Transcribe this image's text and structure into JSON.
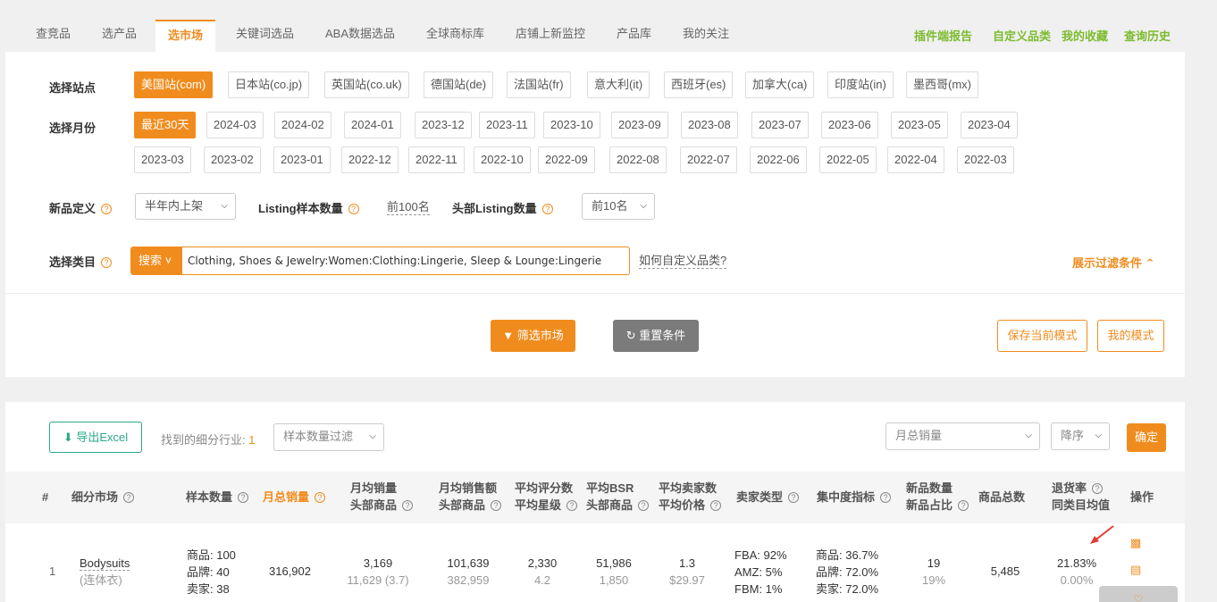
{
  "tabs": [
    "查竞品",
    "选产品",
    "选市场",
    "关键词选品",
    "ABA数据选品",
    "全球商标库",
    "店铺上新监控",
    "产品库",
    "我的关注"
  ],
  "top_links": [
    "插件端报告",
    "自定义品类",
    "我的收藏",
    "查询历史"
  ],
  "filters": {
    "site_label": "选择站点",
    "sites": [
      "美国站(com)",
      "日本站(co.jp)",
      "英国站(co.uk)",
      "德国站(de)",
      "法国站(fr)",
      "意大利(it)",
      "西班牙(es)",
      "加拿大(ca)",
      "印度站(in)",
      "墨西哥(mx)"
    ],
    "month_label": "选择月份",
    "months_row1": [
      "最近30天",
      "2024-03",
      "2024-02",
      "2024-01",
      "2023-12",
      "2023-11",
      "2023-10",
      "2023-09",
      "2023-08",
      "2023-07",
      "2023-06",
      "2023-05",
      "2023-04"
    ],
    "months_row2": [
      "2023-03",
      "2023-02",
      "2023-01",
      "2022-12",
      "2022-11",
      "2022-10",
      "2022-09",
      "2022-08",
      "2022-07",
      "2022-06",
      "2022-05",
      "2022-04",
      "2022-03"
    ],
    "newdef_label": "新品定义",
    "newdef_value": "半年内上架",
    "listing_label": "Listing样本数量",
    "listing_value": "前100名",
    "head_label": "头部Listing数量",
    "head_value": "前10名",
    "category_label": "选择类目",
    "search_btn": "搜索",
    "category_value": "Clothing, Shoes & Jewelry:Women:Clothing:Lingerie, Sleep & Lounge:Lingerie",
    "custom_link": "如何自定义品类?",
    "expand": "展示过滤条件",
    "filter_btn": "筛选市场",
    "reset_btn": "重置条件",
    "save_btn": "保存当前模式",
    "my_mode_btn": "我的模式"
  },
  "results": {
    "export_btn": "导出Excel",
    "found_label": "找到的细分行业:",
    "found_count": "1",
    "sample_filter": "样本数量过滤",
    "sort_field": "月总销量",
    "sort_order": "降序",
    "confirm": "确定",
    "headers": {
      "idx": "#",
      "market": "细分市场",
      "sample": "样本数量",
      "total_sales": "月总销量",
      "avg_sales_1": "月均销量",
      "avg_sales_2": "头部商品",
      "avg_rev_1": "月均销售额",
      "avg_rev_2": "头部商品",
      "rating_1": "平均评分数",
      "rating_2": "平均星级",
      "bsr_1": "平均BSR",
      "bsr_2": "头部商品",
      "seller_1": "平均卖家数",
      "seller_2": "平均价格",
      "seller_type": "卖家类型",
      "concentration": "集中度指标",
      "newcount_1": "新品数量",
      "newcount_2": "新品占比",
      "total_products": "商品总数",
      "return_1": "退货率",
      "return_2": "同类目均值",
      "ops": "操作"
    },
    "rows": [
      {
        "idx": "1",
        "market": "Bodysuits",
        "market_cn": "(连体衣)",
        "sample_products": "商品: 100",
        "sample_brands": "品牌: 40",
        "sample_sellers": "卖家: 38",
        "total_sales": "316,902",
        "avg_sales": "3,169",
        "avg_sales_head": "11,629 (3.7)",
        "avg_rev": "101,639",
        "avg_rev_head": "382,959",
        "rating_count": "2,330",
        "rating_star": "4.2",
        "bsr": "51,986",
        "bsr_head": "1,850",
        "sellers": "1.3",
        "price": "$29.97",
        "fba": "FBA: 92%",
        "amz": "AMZ: 5%",
        "fbm": "FBM: 1%",
        "conc_products": "商品: 36.7%",
        "conc_brands": "品牌: 72.0%",
        "conc_sellers": "卖家: 72.0%",
        "new_count": "19",
        "new_ratio": "19%",
        "total_products": "5,485",
        "return_rate": "21.83%",
        "return_avg": "0.00%"
      }
    ]
  }
}
